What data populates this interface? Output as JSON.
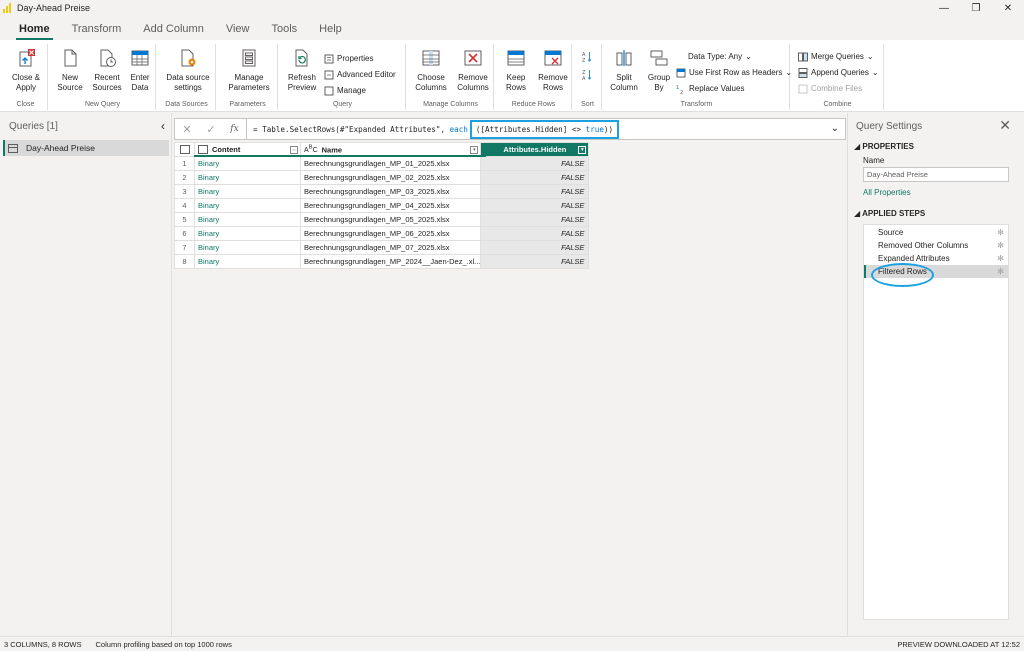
{
  "window": {
    "title": "Day-Ahead Preise",
    "controls": [
      "—",
      "❐",
      "✕"
    ]
  },
  "tabs": [
    {
      "label": "Home",
      "active": true
    },
    {
      "label": "Transform",
      "active": false
    },
    {
      "label": "Add Column",
      "active": false
    },
    {
      "label": "View",
      "active": false
    },
    {
      "label": "Tools",
      "active": false
    },
    {
      "label": "Help",
      "active": false
    }
  ],
  "ribbon": {
    "close": {
      "btn_line1": "Close &",
      "btn_line2": "Apply",
      "group": "Close"
    },
    "new_query": {
      "new_line1": "New",
      "new_line2": "Source",
      "recent_line1": "Recent",
      "recent_line2": "Sources",
      "enter_line1": "Enter",
      "enter_line2": "Data",
      "group": "New Query"
    },
    "data_sources": {
      "btn_line1": "Data source",
      "btn_line2": "settings",
      "group": "Data Sources"
    },
    "parameters": {
      "btn_line1": "Manage",
      "btn_line2": "Parameters",
      "group": "Parameters"
    },
    "query": {
      "refresh_line1": "Refresh",
      "refresh_line2": "Preview",
      "properties": "Properties",
      "advanced_editor": "Advanced Editor",
      "manage": "Manage",
      "group": "Query"
    },
    "manage_columns": {
      "choose_line1": "Choose",
      "choose_line2": "Columns",
      "remove_line1": "Remove",
      "remove_line2": "Columns",
      "group": "Manage Columns"
    },
    "reduce_rows": {
      "keep_line1": "Keep",
      "keep_line2": "Rows",
      "remove_line1": "Remove",
      "remove_line2": "Rows",
      "group": "Reduce Rows"
    },
    "sort": {
      "group": "Sort"
    },
    "transform": {
      "split_line1": "Split",
      "split_line2": "Column",
      "group_line1": "Group",
      "group_line2": "By",
      "data_type": "Data Type: Any",
      "first_row": "Use First Row as Headers",
      "replace": "Replace Values",
      "group": "Transform"
    },
    "combine": {
      "merge": "Merge Queries",
      "append": "Append Queries",
      "combine_files": "Combine Files",
      "group": "Combine"
    }
  },
  "queries_pane": {
    "header": "Queries [1]",
    "items": [
      "Day-Ahead Preise"
    ]
  },
  "formula_bar": {
    "prefix": "= Table.SelectRows(#\"Expanded Attributes\", ",
    "each_kw": "each",
    "highlight_pre": "([Attributes.Hidden] <> ",
    "true_kw": "true",
    "highlight_post": "))"
  },
  "grid": {
    "columns": [
      "Content",
      "Name",
      "Attributes.Hidden"
    ],
    "rows": [
      {
        "n": "1",
        "content": "Binary",
        "name": "Berechnungsgrundlagen_MP_01_2025.xlsx",
        "hidden": "FALSE"
      },
      {
        "n": "2",
        "content": "Binary",
        "name": "Berechnungsgrundlagen_MP_02_2025.xlsx",
        "hidden": "FALSE"
      },
      {
        "n": "3",
        "content": "Binary",
        "name": "Berechnungsgrundlagen_MP_03_2025.xlsx",
        "hidden": "FALSE"
      },
      {
        "n": "4",
        "content": "Binary",
        "name": "Berechnungsgrundlagen_MP_04_2025.xlsx",
        "hidden": "FALSE"
      },
      {
        "n": "5",
        "content": "Binary",
        "name": "Berechnungsgrundlagen_MP_05_2025.xlsx",
        "hidden": "FALSE"
      },
      {
        "n": "6",
        "content": "Binary",
        "name": "Berechnungsgrundlagen_MP_06_2025.xlsx",
        "hidden": "FALSE"
      },
      {
        "n": "7",
        "content": "Binary",
        "name": "Berechnungsgrundlagen_MP_07_2025.xlsx",
        "hidden": "FALSE"
      },
      {
        "n": "8",
        "content": "Binary",
        "name": "Berechnungsgrundlagen_MP_2024__Jaen-Dez_.xl...",
        "hidden": "FALSE"
      }
    ]
  },
  "settings": {
    "title": "Query Settings",
    "properties_header": "PROPERTIES",
    "name_label": "Name",
    "name_value": "Day-Ahead Preise",
    "all_properties": "All Properties",
    "steps_header": "APPLIED STEPS",
    "steps": [
      "Source",
      "Removed Other Columns",
      "Expanded Attributes",
      "Filtered Rows"
    ]
  },
  "status": {
    "left": "3 COLUMNS, 8 ROWS",
    "profiling": "Column profiling based on top 1000 rows",
    "right": "PREVIEW DOWNLOADED AT 12:52"
  },
  "colors": {
    "accent": "#117865",
    "highlight": "#1ba1e2",
    "logo": "#f2c811"
  }
}
